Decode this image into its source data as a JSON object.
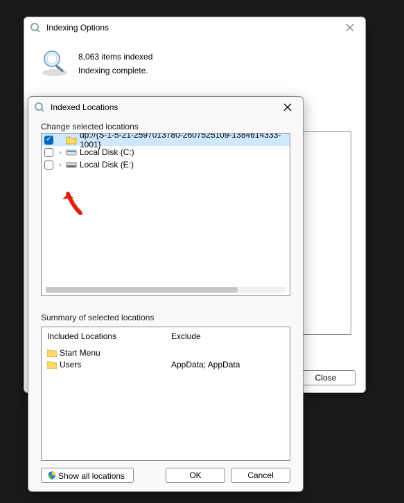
{
  "parent": {
    "title": "Indexing Options",
    "items_indexed": "8,063 items indexed",
    "status": "Indexing complete.",
    "close_label": "Close"
  },
  "child": {
    "title": "Indexed Locations",
    "change_label": "Change selected locations",
    "tree": [
      {
        "checked": true,
        "expandable": false,
        "icon": "folder",
        "label": "dp://{S-1-5-21-2597013780-2607525109-1384614333-1001}"
      },
      {
        "checked": false,
        "expandable": true,
        "icon": "disk-c",
        "label": "Local Disk (C:)"
      },
      {
        "checked": false,
        "expandable": true,
        "icon": "disk-e",
        "label": "Local Disk (E:)"
      }
    ],
    "summary_label": "Summary of selected locations",
    "summary": {
      "included_header": "Included Locations",
      "exclude_header": "Exclude",
      "included": [
        "Start Menu",
        "Users"
      ],
      "exclude": [
        "",
        "AppData; AppData"
      ]
    },
    "buttons": {
      "show_all": "Show all locations",
      "ok": "OK",
      "cancel": "Cancel"
    }
  }
}
